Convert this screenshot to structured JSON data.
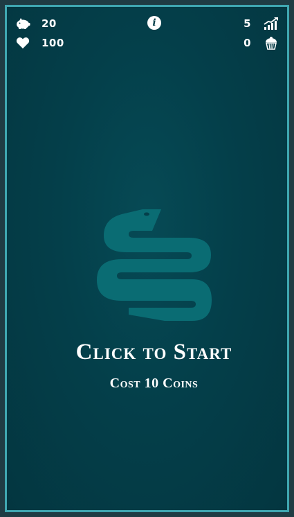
{
  "hud": {
    "coins": {
      "icon": "piggy-bank-icon",
      "value": "20"
    },
    "health": {
      "icon": "heart-icon",
      "value": "100"
    },
    "level": {
      "icon": "chart-growth-icon",
      "value": "5"
    },
    "treats": {
      "icon": "cupcake-icon",
      "value": "0"
    },
    "info": {
      "icon": "info-icon",
      "label": "i"
    }
  },
  "start": {
    "title": "Click to Start",
    "cost": "Cost 10 Coins"
  },
  "colors": {
    "background": "#043f4a",
    "border": "#3fa7b1",
    "snake": "#0a6c73",
    "text": "#ffffff"
  },
  "logo": {
    "icon": "snake-logo-icon"
  }
}
